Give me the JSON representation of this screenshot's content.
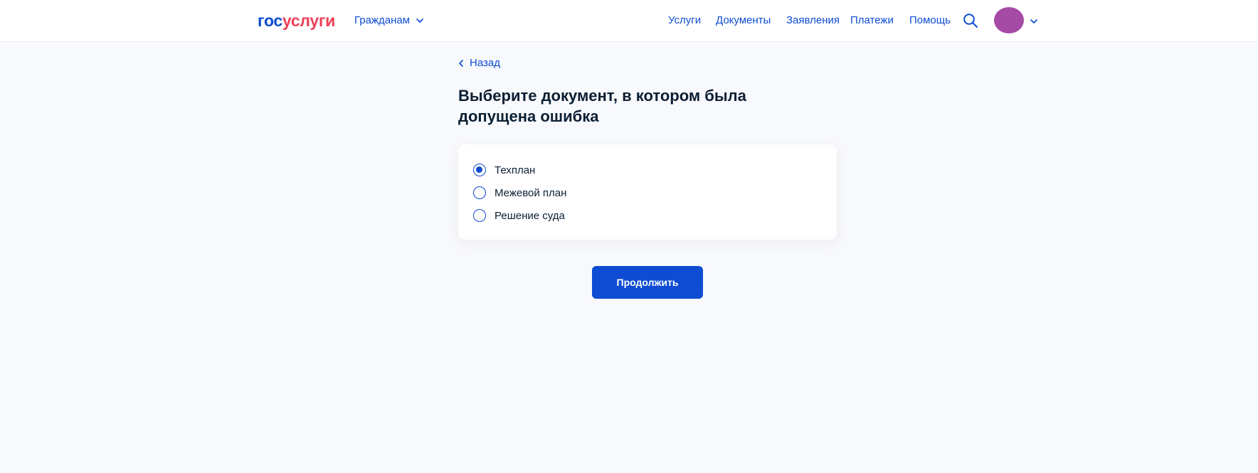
{
  "header": {
    "logo_part1": "гос",
    "logo_part2": "услуги",
    "audience_label": "Гражданам",
    "nav": [
      "Услуги",
      "Документы",
      "Заявления",
      "Платежи",
      "Помощь"
    ]
  },
  "icons": {
    "search": "search-icon",
    "chevron": "chevron-down-icon",
    "back": "chevron-left-icon"
  },
  "colors": {
    "primary": "#0d4cd3",
    "logo_red": "#ee3f58",
    "avatar": "#a54ba6",
    "background": "#f8f9fc"
  },
  "main": {
    "back_label": "Назад",
    "title": "Выберите документ, в котором была допущена ошибка",
    "options": [
      {
        "label": "Техплан",
        "selected": true
      },
      {
        "label": "Межевой план",
        "selected": false
      },
      {
        "label": "Решение суда",
        "selected": false
      }
    ],
    "continue_label": "Продолжить"
  }
}
